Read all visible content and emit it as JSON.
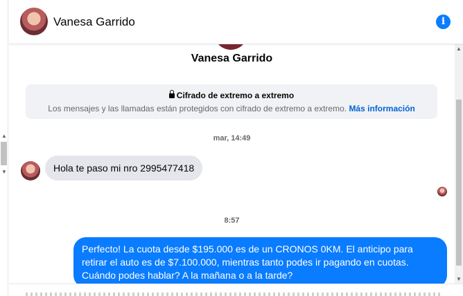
{
  "header": {
    "contact_name": "Vanesa Garrido",
    "info_icon": "info-icon"
  },
  "profile": {
    "name": "Vanesa Garrido"
  },
  "encryption_notice": {
    "title": "Cifrado de extremo a extremo",
    "description": "Los mensajes y las llamadas están protegidos con cifrado de extremo a extremo.",
    "link": "Más información"
  },
  "messages": [
    {
      "timestamp": "mar, 14:49",
      "direction": "incoming",
      "text": "Hola te paso mi nro 2995477418"
    },
    {
      "timestamp": "8:57",
      "direction": "outgoing",
      "text": "Perfecto! La cuota desde $195.000 es de un CRONOS 0KM. El anticipo para retirar el auto es de $7.100.000, mientras tanto podes ir pagando en cuotas. Cuándo podes hablar? A la mañana o a la tarde?"
    }
  ],
  "colors": {
    "accent": "#0a7cff",
    "incoming_bubble": "#e4e6eb",
    "link": "#0064d1"
  }
}
